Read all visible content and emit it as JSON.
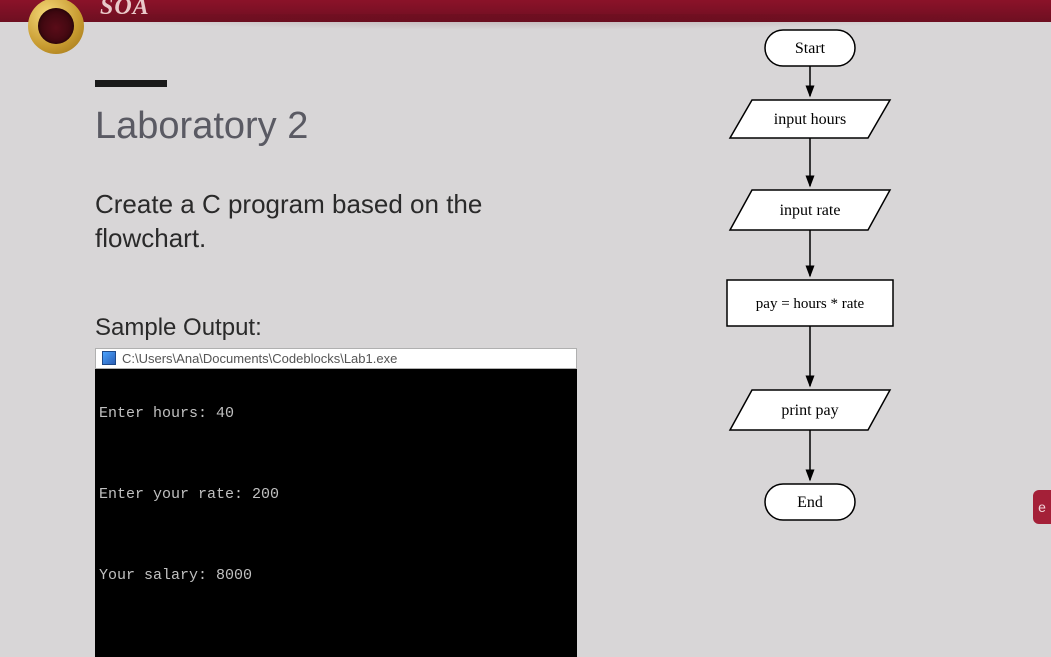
{
  "brand": {
    "text": "SOA"
  },
  "slide": {
    "title": "Laboratory 2",
    "instruction": "Create a C program based on the flowchart.",
    "sample_output_label": "Sample Output:"
  },
  "console": {
    "title_path": "C:\\Users\\Ana\\Documents\\Codeblocks\\Lab1.exe",
    "lines": [
      "Enter hours: 40",
      "",
      "Enter your rate: 200",
      "",
      "Your salary: 8000"
    ]
  },
  "flowchart": {
    "nodes": {
      "start": "Start",
      "input_hours": "input  hours",
      "input_rate": "input rate",
      "process": "pay = hours * rate",
      "print": "print pay",
      "end": "End"
    }
  },
  "side_tab": {
    "glyph": "e"
  }
}
